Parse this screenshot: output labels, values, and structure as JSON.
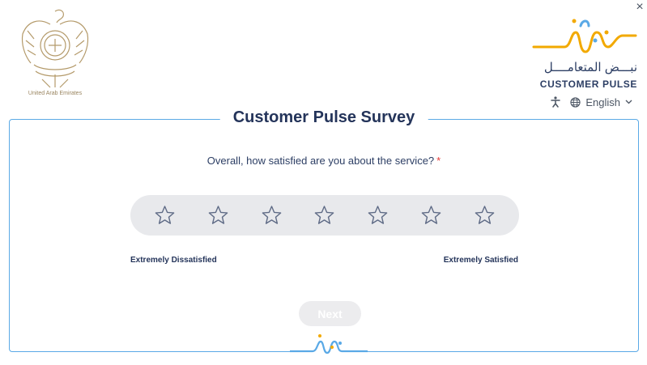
{
  "header": {
    "emblem_caption": "United Arab Emirates",
    "brand_arabic": "نبـــض المتعامــــل",
    "brand_latin": "CUSTOMER PULSE",
    "close_label": "×",
    "language": "English"
  },
  "survey": {
    "title": "Customer Pulse Survey",
    "question": "Overall, how satisfied are you about the service?",
    "required_mark": "*",
    "rating": {
      "max": 7,
      "selected": 0
    },
    "min_label": "Extremely Dissatisfied",
    "max_label": "Extremely Satisfied",
    "next_label": "Next"
  },
  "colors": {
    "primary_blue": "#5aa9e6",
    "logo_gold": "#f2a900",
    "navy": "#24345a",
    "required": "#e53935"
  },
  "icons": [
    "uae-emblem-icon",
    "close-icon",
    "customer-pulse-logo-icon",
    "accessibility-icon",
    "globe-icon",
    "chevron-down-icon",
    "star-outline-icon"
  ]
}
